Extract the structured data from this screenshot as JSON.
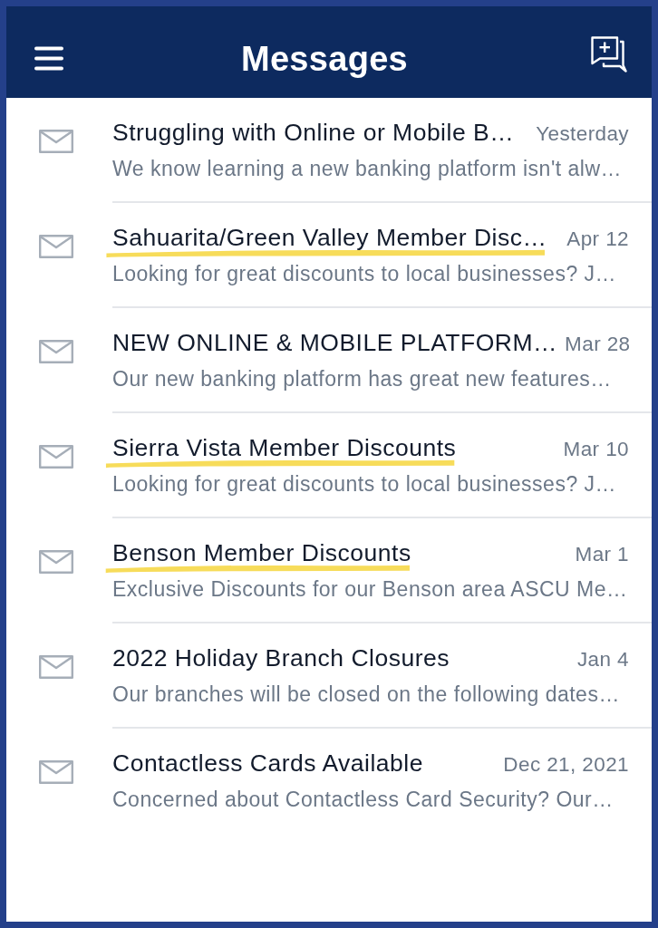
{
  "header": {
    "title": "Messages"
  },
  "messages": [
    {
      "title": "Struggling with Online or Mobile B…",
      "date": "Yesterday",
      "preview": "We know learning a new banking platform isn't alw…",
      "underlined": false
    },
    {
      "title": "Sahuarita/Green Valley Member Disc…",
      "date": "Apr 12",
      "preview": "Looking for great discounts to local businesses? J…",
      "underlined": true
    },
    {
      "title": "NEW ONLINE & MOBILE PLATFORM…",
      "date": "Mar 28",
      "preview": "Our new banking platform has great new features…",
      "underlined": false
    },
    {
      "title": "Sierra Vista Member Discounts",
      "date": "Mar 10",
      "preview": "Looking for great discounts to local businesses? J…",
      "underlined": true
    },
    {
      "title": "Benson Member Discounts",
      "date": "Mar 1",
      "preview": "Exclusive Discounts for our Benson area ASCU Me…",
      "underlined": true
    },
    {
      "title": "2022 Holiday Branch Closures",
      "date": "Jan 4",
      "preview": "Our branches will be closed on the following dates…",
      "underlined": false
    },
    {
      "title": "Contactless Cards Available",
      "date": "Dec 21, 2021",
      "preview": "Concerned about Contactless Card Security? Our…",
      "underlined": false
    }
  ]
}
